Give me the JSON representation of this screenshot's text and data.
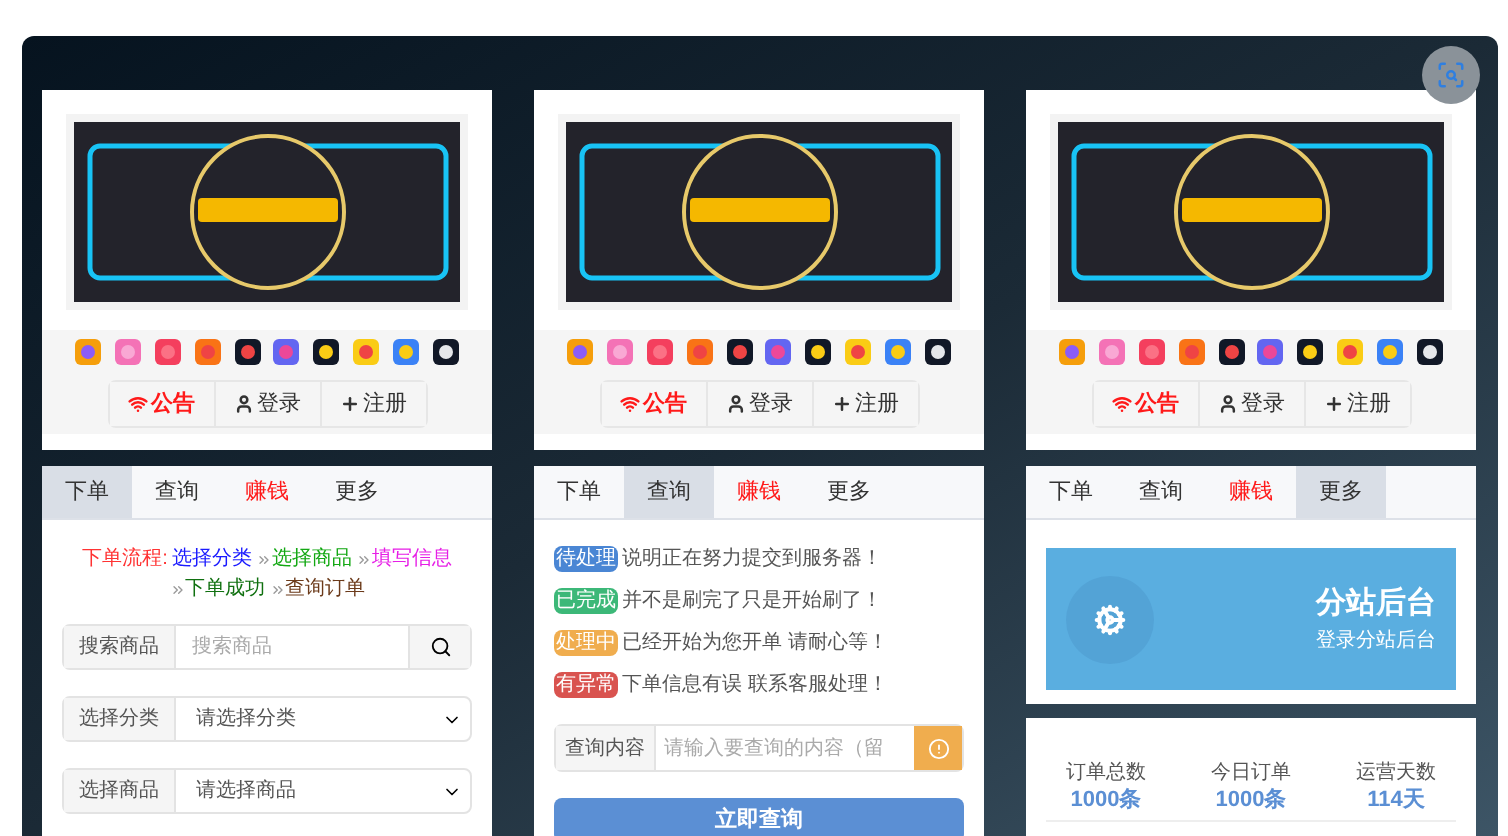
{
  "panels": [
    {
      "header": {
        "buttons": [
          {
            "label": "公告",
            "kind": "notice"
          },
          {
            "label": "登录",
            "kind": "login"
          },
          {
            "label": "注册",
            "kind": "register"
          }
        ]
      },
      "tabs": [
        {
          "label": "下单",
          "selected": true,
          "kind": "normal"
        },
        {
          "label": "查询",
          "selected": false,
          "kind": "normal"
        },
        {
          "label": "赚钱",
          "selected": false,
          "kind": "hot"
        },
        {
          "label": "更多",
          "selected": false,
          "kind": "normal"
        }
      ],
      "content": {
        "kind": "order",
        "flow": [
          {
            "text": "下单流程:",
            "color": "#ff3333"
          },
          {
            "text": "选择分类",
            "color": "#1a1aff"
          },
          {
            "text": "选择商品",
            "color": "#13a813"
          },
          {
            "text": "填写信息",
            "color": "#e61ee6"
          },
          {
            "text": "下单成功",
            "color": "#107010"
          },
          {
            "text": "查询订单",
            "color": "#6b3a1a"
          }
        ],
        "search": {
          "label": "搜索商品",
          "placeholder": "搜索商品"
        },
        "selects": [
          {
            "label": "选择分类",
            "value": "请选择分类"
          },
          {
            "label": "选择商品",
            "value": "请选择商品"
          }
        ]
      }
    },
    {
      "header": {
        "buttons": [
          {
            "label": "公告",
            "kind": "notice"
          },
          {
            "label": "登录",
            "kind": "login"
          },
          {
            "label": "注册",
            "kind": "register"
          }
        ]
      },
      "tabs": [
        {
          "label": "下单",
          "selected": false,
          "kind": "normal"
        },
        {
          "label": "查询",
          "selected": true,
          "kind": "normal"
        },
        {
          "label": "赚钱",
          "selected": false,
          "kind": "hot"
        },
        {
          "label": "更多",
          "selected": false,
          "kind": "normal"
        }
      ],
      "content": {
        "kind": "query",
        "statuses": [
          {
            "badge": "待处理",
            "color": "#4a86d4",
            "text": "说明正在努力提交到服务器！"
          },
          {
            "badge": "已完成",
            "color": "#3cb878",
            "text": "并不是刷完了只是开始刷了！"
          },
          {
            "badge": "处理中",
            "color": "#f0ad4e",
            "text": "已经开始为您开单 请耐心等！"
          },
          {
            "badge": "有异常",
            "color": "#d9534f",
            "text": "下单信息有误 联系客服处理！"
          }
        ],
        "query": {
          "label": "查询内容",
          "placeholder": "请输入要查询的内容（留"
        },
        "button": "立即查询"
      }
    },
    {
      "header": {
        "buttons": [
          {
            "label": "公告",
            "kind": "notice"
          },
          {
            "label": "登录",
            "kind": "login"
          },
          {
            "label": "注册",
            "kind": "register"
          }
        ]
      },
      "tabs": [
        {
          "label": "下单",
          "selected": false,
          "kind": "normal"
        },
        {
          "label": "查询",
          "selected": false,
          "kind": "normal"
        },
        {
          "label": "赚钱",
          "selected": false,
          "kind": "hot"
        },
        {
          "label": "更多",
          "selected": true,
          "kind": "normal"
        }
      ],
      "content": {
        "kind": "more",
        "backend": {
          "title": "分站后台",
          "subtitle": "登录分站后台"
        },
        "stats": [
          {
            "label": "订单总数",
            "value": "1000条"
          },
          {
            "label": "今日订单",
            "value": "1000条"
          },
          {
            "label": "运营天数",
            "value": "114天"
          }
        ]
      }
    }
  ]
}
